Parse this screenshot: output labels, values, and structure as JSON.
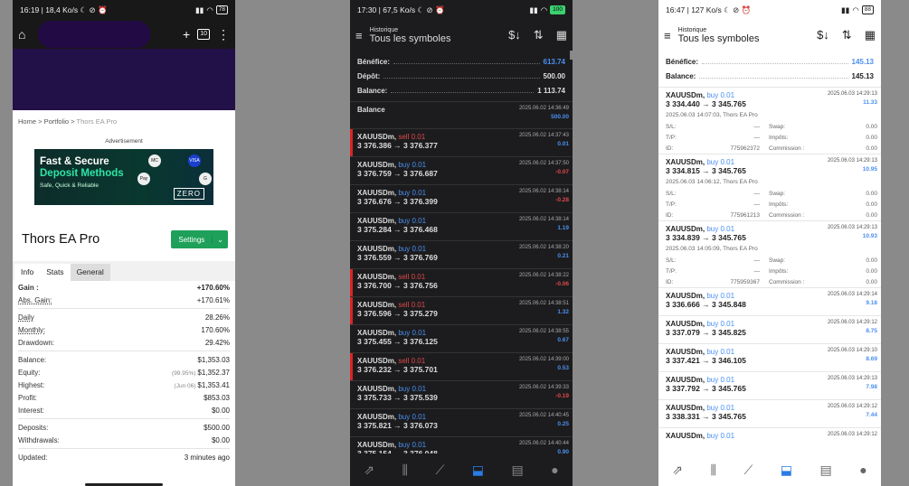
{
  "p1": {
    "status": {
      "left": "16:19 | 18,4 Ko/s ☾ ⊘ ⏰",
      "battery": "78"
    },
    "tabs": "10",
    "breadcrumb": {
      "home": "Home",
      "portfolio": "Portfolio",
      "current": "Thors EA Pro"
    },
    "advertisement": "Advertisement",
    "ad": {
      "line1": "Fast & Secure",
      "line2": "Deposit Methods",
      "line3": "Safe, Quick & Reliable",
      "logo": "ZERO"
    },
    "title": "Thors EA Pro",
    "settings": "Settings",
    "tabs_list": [
      "Info",
      "Stats",
      "General"
    ],
    "rows": [
      {
        "l": "Gain :",
        "v": "+170.60%",
        "green": true,
        "bold": true
      },
      {
        "l": "Abs. Gain:",
        "v": "+170.61%",
        "green": true,
        "u": true
      },
      {
        "sep": true
      },
      {
        "l": "Daily",
        "v": "28.26%",
        "u": true
      },
      {
        "l": "Monthly:",
        "v": "170.60%",
        "u": true
      },
      {
        "l": "Drawdown:",
        "v": "29.42%"
      },
      {
        "sep": true
      },
      {
        "l": "Balance:",
        "v": "$1,353.03"
      },
      {
        "l": "Equity:",
        "pre": "(99.95%)",
        "v": "$1,352.37"
      },
      {
        "l": "Highest:",
        "pre": "(Jun 06)",
        "v": "$1,353.41"
      },
      {
        "l": "Profit:",
        "v": "$853.03",
        "green": true
      },
      {
        "l": "Interest:",
        "v": "$0.00"
      },
      {
        "sep": true
      },
      {
        "l": "Deposits:",
        "v": "$500.00"
      },
      {
        "l": "Withdrawals:",
        "v": "$0.00"
      },
      {
        "sep": true
      },
      {
        "l": "Updated:",
        "v": "3 minutes ago"
      }
    ]
  },
  "p2": {
    "status": {
      "left": "17:30 | 67,5 Ko/s ☾ ⊘ ⏰",
      "battery": "100"
    },
    "subtitle": "Historique",
    "title": "Tous les symboles",
    "summary": [
      {
        "l": "Bénéfice:",
        "v": "613.74",
        "blue": true
      },
      {
        "l": "Dépôt:",
        "v": "500.00"
      },
      {
        "l": "Balance:",
        "v": "1 113.74"
      }
    ],
    "balance": {
      "l": "Balance",
      "d": "2025.06.02 14:36:49",
      "v": "500.00"
    },
    "trades": [
      {
        "sym": "XAUUSDm,",
        "side": "sell 0.01",
        "px": "3 376.386 → 3 376.377",
        "d": "2025.06.02 14:37:43",
        "pf": "0.01",
        "neg": false
      },
      {
        "sym": "XAUUSDm,",
        "side": "buy 0.01",
        "px": "3 376.759 → 3 376.687",
        "d": "2025.06.02 14:37:50",
        "pf": "-0.07",
        "neg": true
      },
      {
        "sym": "XAUUSDm,",
        "side": "buy 0.01",
        "px": "3 376.676 → 3 376.399",
        "d": "2025.06.02 14:38:14",
        "pf": "-0.28",
        "neg": true
      },
      {
        "sym": "XAUUSDm,",
        "side": "buy 0.01",
        "px": "3 375.284 → 3 376.468",
        "d": "2025.06.02 14:38:14",
        "pf": "1.19",
        "neg": false
      },
      {
        "sym": "XAUUSDm,",
        "side": "buy 0.01",
        "px": "3 376.559 → 3 376.769",
        "d": "2025.06.02 14:38:20",
        "pf": "0.21",
        "neg": false
      },
      {
        "sym": "XAUUSDm,",
        "side": "sell 0.01",
        "px": "3 376.700 → 3 376.756",
        "d": "2025.06.02 14:38:22",
        "pf": "-0.06",
        "neg": true
      },
      {
        "sym": "XAUUSDm,",
        "side": "sell 0.01",
        "px": "3 376.596 → 3 375.279",
        "d": "2025.06.02 14:38:51",
        "pf": "1.32",
        "neg": false
      },
      {
        "sym": "XAUUSDm,",
        "side": "buy 0.01",
        "px": "3 375.455 → 3 376.125",
        "d": "2025.06.02 14:38:55",
        "pf": "0.67",
        "neg": false
      },
      {
        "sym": "XAUUSDm,",
        "side": "sell 0.01",
        "px": "3 376.232 → 3 375.701",
        "d": "2025.06.02 14:39:00",
        "pf": "0.53",
        "neg": false
      },
      {
        "sym": "XAUUSDm,",
        "side": "buy 0.01",
        "px": "3 375.733 → 3 375.539",
        "d": "2025.06.02 14:39:33",
        "pf": "-0.19",
        "neg": true
      },
      {
        "sym": "XAUUSDm,",
        "side": "buy 0.01",
        "px": "3 375.821 → 3 376.073",
        "d": "2025.06.02 14:40:45",
        "pf": "0.25",
        "neg": false
      },
      {
        "sym": "XAUUSDm,",
        "side": "buy 0.01",
        "px": "3 375.154 → 3 376.048",
        "d": "2025.06.02 14:40:44",
        "pf": "0.90",
        "neg": false
      }
    ]
  },
  "p3": {
    "status": {
      "left": "16:47 | 127 Ko/s ☾ ⊘ ⏰",
      "battery": "88"
    },
    "subtitle": "Historique",
    "title": "Tous les symboles",
    "summary": [
      {
        "l": "Bénéfice:",
        "v": "145.13",
        "blue": true
      },
      {
        "l": "Balance:",
        "v": "145.13"
      }
    ],
    "labels": {
      "sl": "S/L:",
      "tp": "T/P:",
      "id": "ID:",
      "swap": "Swap:",
      "tax": "Impôts:",
      "comm": "Commission :",
      "dash": "—",
      "zero": "0.00"
    },
    "detailed": [
      {
        "sym": "XAUUSDm,",
        "side": "buy 0.01",
        "px": "3 334.440 → 3 345.765",
        "d": "2025.06.03 14:29:13",
        "pf": "11.33",
        "open": "2025.06.03 14:07:03, Thors EA Pro",
        "id": "775962372"
      },
      {
        "sym": "XAUUSDm,",
        "side": "buy 0.01",
        "px": "3 334.815 → 3 345.765",
        "d": "2025.06.03 14:29:13",
        "pf": "10.95",
        "open": "2025.06.03 14:06:12, Thors EA Pro",
        "id": "775961213"
      },
      {
        "sym": "XAUUSDm,",
        "side": "buy 0.01",
        "px": "3 334.839 → 3 345.765",
        "d": "2025.06.03 14:29:13",
        "pf": "10.93",
        "open": "2025.06.03 14:05:09, Thors EA Pro",
        "id": "775959367"
      }
    ],
    "trades": [
      {
        "sym": "XAUUSDm,",
        "side": "buy 0.01",
        "px": "3 336.666 → 3 345.848",
        "d": "2025.06.03 14:29:14",
        "pf": "9.18"
      },
      {
        "sym": "XAUUSDm,",
        "side": "buy 0.01",
        "px": "3 337.079 → 3 345.825",
        "d": "2025.06.03 14:29:12",
        "pf": "8.75"
      },
      {
        "sym": "XAUUSDm,",
        "side": "buy 0.01",
        "px": "3 337.421 → 3 346.105",
        "d": "2025.06.03 14:29:10",
        "pf": "8.69"
      },
      {
        "sym": "XAUUSDm,",
        "side": "buy 0.01",
        "px": "3 337.792 → 3 345.765",
        "d": "2025.06.03 14:29:13",
        "pf": "7.98"
      },
      {
        "sym": "XAUUSDm,",
        "side": "buy 0.01",
        "px": "3 338.331 → 3 345.765",
        "d": "2025.06.03 14:29:12",
        "pf": "7.44"
      },
      {
        "sym": "XAUUSDm,",
        "side": "buy 0.01",
        "px": "",
        "d": "2025.06.03 14:29:12",
        "pf": ""
      }
    ]
  },
  "nav_icons": [
    "trade-icon",
    "quotes-icon",
    "chart-icon",
    "history-icon",
    "news-icon",
    "chat-icon"
  ]
}
